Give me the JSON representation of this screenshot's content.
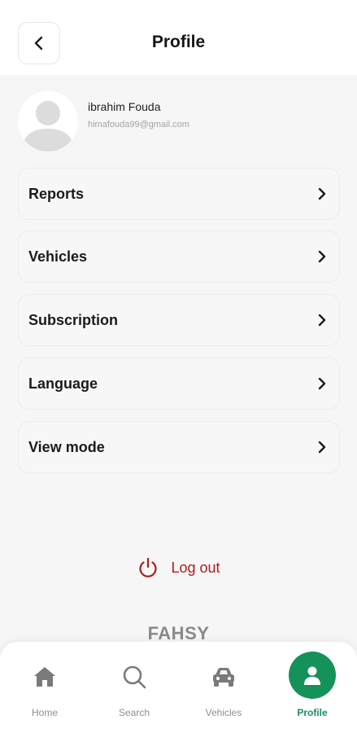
{
  "header": {
    "title": "Profile"
  },
  "user": {
    "name": "ibrahim Fouda",
    "email": "himafouda99@gmail.com"
  },
  "menu": [
    {
      "label": "Reports"
    },
    {
      "label": "Vehicles"
    },
    {
      "label": "Subscription"
    },
    {
      "label": "Language"
    },
    {
      "label": "View mode"
    }
  ],
  "logout": {
    "label": "Log out"
  },
  "brand": {
    "text": "FAHSY"
  },
  "bottom_nav": [
    {
      "label": "Home",
      "icon": "home-icon"
    },
    {
      "label": "Search",
      "icon": "search-icon"
    },
    {
      "label": "Vehicles",
      "icon": "car-icon"
    },
    {
      "label": "Profile",
      "icon": "user-icon",
      "active": true
    }
  ],
  "colors": {
    "accent": "#15915a",
    "danger": "#b01b1b",
    "background": "#f6f6f6"
  }
}
